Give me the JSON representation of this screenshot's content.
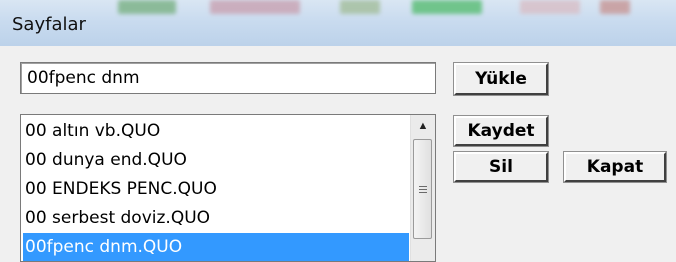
{
  "window": {
    "title": "Sayfalar"
  },
  "form": {
    "name_input_value": "00fpenc dnm"
  },
  "buttons": {
    "load_label": "Yükle",
    "save_label": "Kaydet",
    "delete_label": "Sil",
    "close_label": "Kapat"
  },
  "list": {
    "items": [
      {
        "label": "00 altın vb.QUO",
        "selected": false
      },
      {
        "label": "00 dunya end.QUO",
        "selected": false
      },
      {
        "label": "00 ENDEKS PENC.QUO",
        "selected": false
      },
      {
        "label": "00 serbest doviz.QUO",
        "selected": false
      },
      {
        "label": "00fpenc dnm.QUO",
        "selected": true
      }
    ]
  },
  "colors": {
    "selection": "#3399ff",
    "window_bg": "#f0f0f0"
  },
  "icons": {
    "scroll_up": "▲"
  }
}
